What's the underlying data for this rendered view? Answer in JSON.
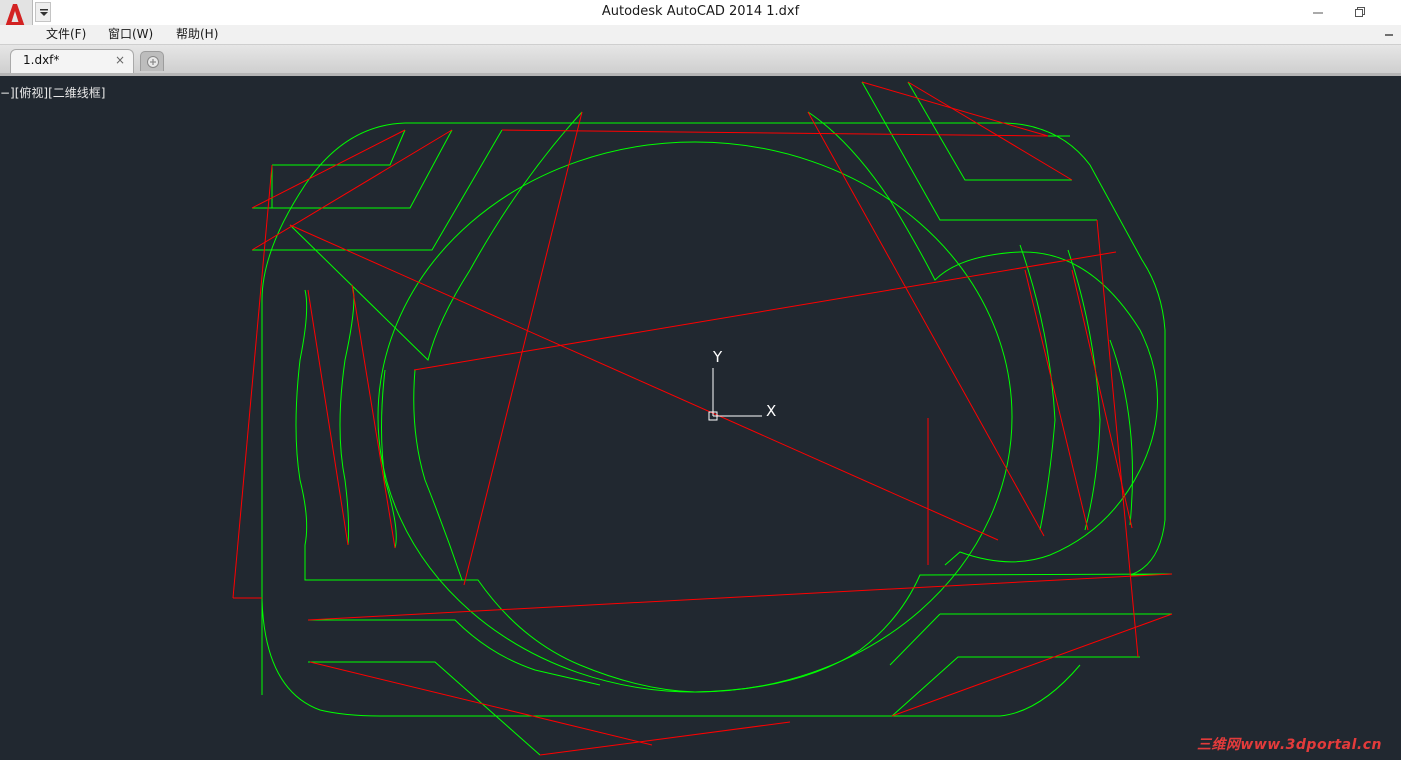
{
  "window": {
    "title": "Autodesk AutoCAD 2014     1.dxf",
    "minimize_icon": "minimize-icon",
    "restore_icon": "restore-icon"
  },
  "app_button": {
    "icon": "autocad-logo-icon"
  },
  "menubar": {
    "items": [
      {
        "label": "文件(F)"
      },
      {
        "label": "窗口(W)"
      },
      {
        "label": "帮助(H)"
      }
    ]
  },
  "tabs": {
    "items": [
      {
        "label": "1.dxf*",
        "close": "×"
      }
    ],
    "new_tab_icon": "new-tab-icon"
  },
  "viewport": {
    "label": "−][俯视][二维线框]",
    "ucs": {
      "y_label": "Y",
      "x_label": "X"
    }
  },
  "colors": {
    "background": "#212830",
    "green_lines": "#00ff00",
    "red_lines": "#ff0000"
  },
  "watermark": "三维网www.3dportal.cn"
}
